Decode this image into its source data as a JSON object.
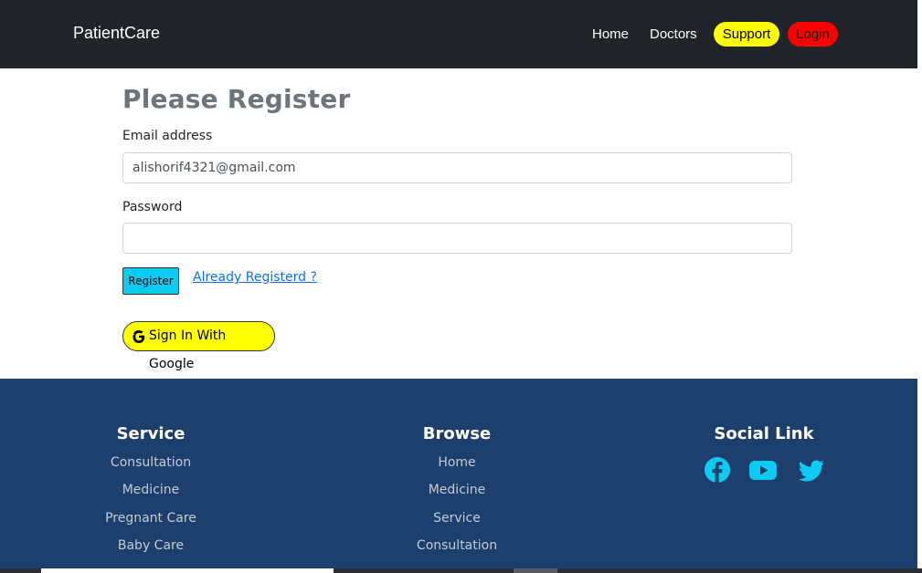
{
  "navbar": {
    "brand": "PatientCare",
    "links": {
      "home": "Home",
      "doctors": "Doctors"
    },
    "support_label": "Support",
    "login_label": "Login"
  },
  "form": {
    "title": "Please Register",
    "email_label": "Email address",
    "email_value": "alishorif4321@gmail.com",
    "password_label": "Password",
    "password_value": "",
    "register_label": "Register",
    "already_link": "Already Registerd ?",
    "google_label": "Sign In With Google"
  },
  "footer": {
    "service": {
      "title": "Service",
      "items": [
        "Consultation",
        "Medicine",
        "Pregnant Care",
        "Baby Care"
      ]
    },
    "browse": {
      "title": "Browse",
      "items": [
        "Home",
        "Medicine",
        "Service",
        "Consultation"
      ]
    },
    "social": {
      "title": "Social Link",
      "icons": [
        "facebook-icon",
        "youtube-icon",
        "twitter-icon"
      ]
    }
  },
  "colors": {
    "navbar_bg": "#212529",
    "footer_bg": "#1c3f6e",
    "support_pill": "#ffff00",
    "login_pill": "#ff0000",
    "register_btn": "#0dcaf0",
    "social_icon": "#0dcaf0"
  }
}
